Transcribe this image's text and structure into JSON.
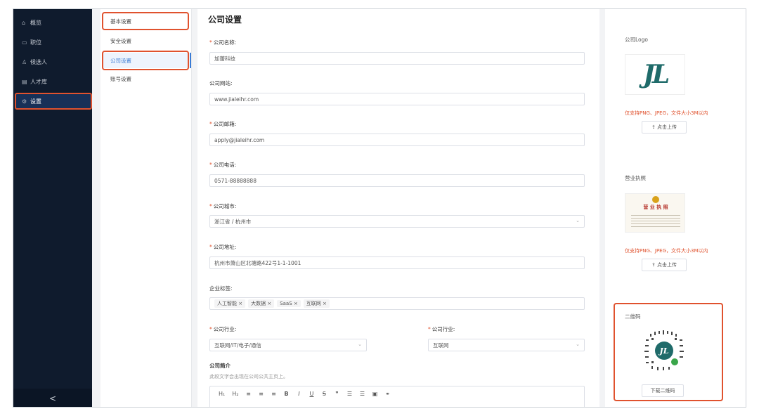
{
  "sidebar": {
    "items": [
      {
        "icon": "⌂",
        "label": "概览"
      },
      {
        "icon": "▭",
        "label": "职位"
      },
      {
        "icon": "♙",
        "label": "候选人"
      },
      {
        "icon": "▤",
        "label": "人才库"
      },
      {
        "icon": "⚙",
        "label": "设置"
      }
    ],
    "collapse": "<"
  },
  "submenu": {
    "items": [
      "基本设置",
      "安全设置",
      "公司设置",
      "账号设置"
    ],
    "active_index": 2
  },
  "page": {
    "title": "公司设置"
  },
  "form": {
    "name_label": "公司名称:",
    "name_value": "加蕾科技",
    "site_label": "公司网站:",
    "site_value": "www.jialeihr.com",
    "email_label": "公司邮箱:",
    "email_value": "apply@jialeihr.com",
    "phone_label": "公司电话:",
    "phone_value": "0571-88888888",
    "city_label": "公司城市:",
    "city_value": "浙江省 / 杭州市",
    "address_label": "公司地址:",
    "address_value": "杭州市萧山区北塘路422号1-1-1001",
    "tags_label": "企业标签:",
    "tags": [
      "人工智能 ×",
      "大数据 ×",
      "SaaS ×",
      "互联网 ×"
    ],
    "industry_label": "公司行业:",
    "industry_value": "互联网/IT/电子/通信",
    "industry2_label": "公司行业:",
    "industry2_value": "互联网",
    "intro_label": "公司简介",
    "intro_note": "此段文字会出现在公司公共主页上。",
    "toolbar": [
      "H₁",
      "H₂",
      "≡",
      "≡",
      "≡",
      "B",
      "I",
      "U",
      "S",
      "❞",
      "☰",
      "☰",
      "▣",
      "⚭"
    ]
  },
  "right": {
    "logo_label": "公司Logo",
    "logo_text": "JL",
    "logo_warn": "仅支持PNG、JPEG，文件大小3M以内",
    "upload_label": "⇪ 点击上传",
    "license_label": "营业执照",
    "license_title": "营 业 执 照",
    "license_warn": "仅支持PNG、JPEG，文件大小3M以内",
    "upload_label2": "⇪ 点击上传",
    "qr_label": "二维码",
    "qr_download": "下载二维码"
  },
  "colors": {
    "accent": "#3a7bd5",
    "highlight": "#e0522e",
    "sidebar": "#0f1b2d"
  }
}
